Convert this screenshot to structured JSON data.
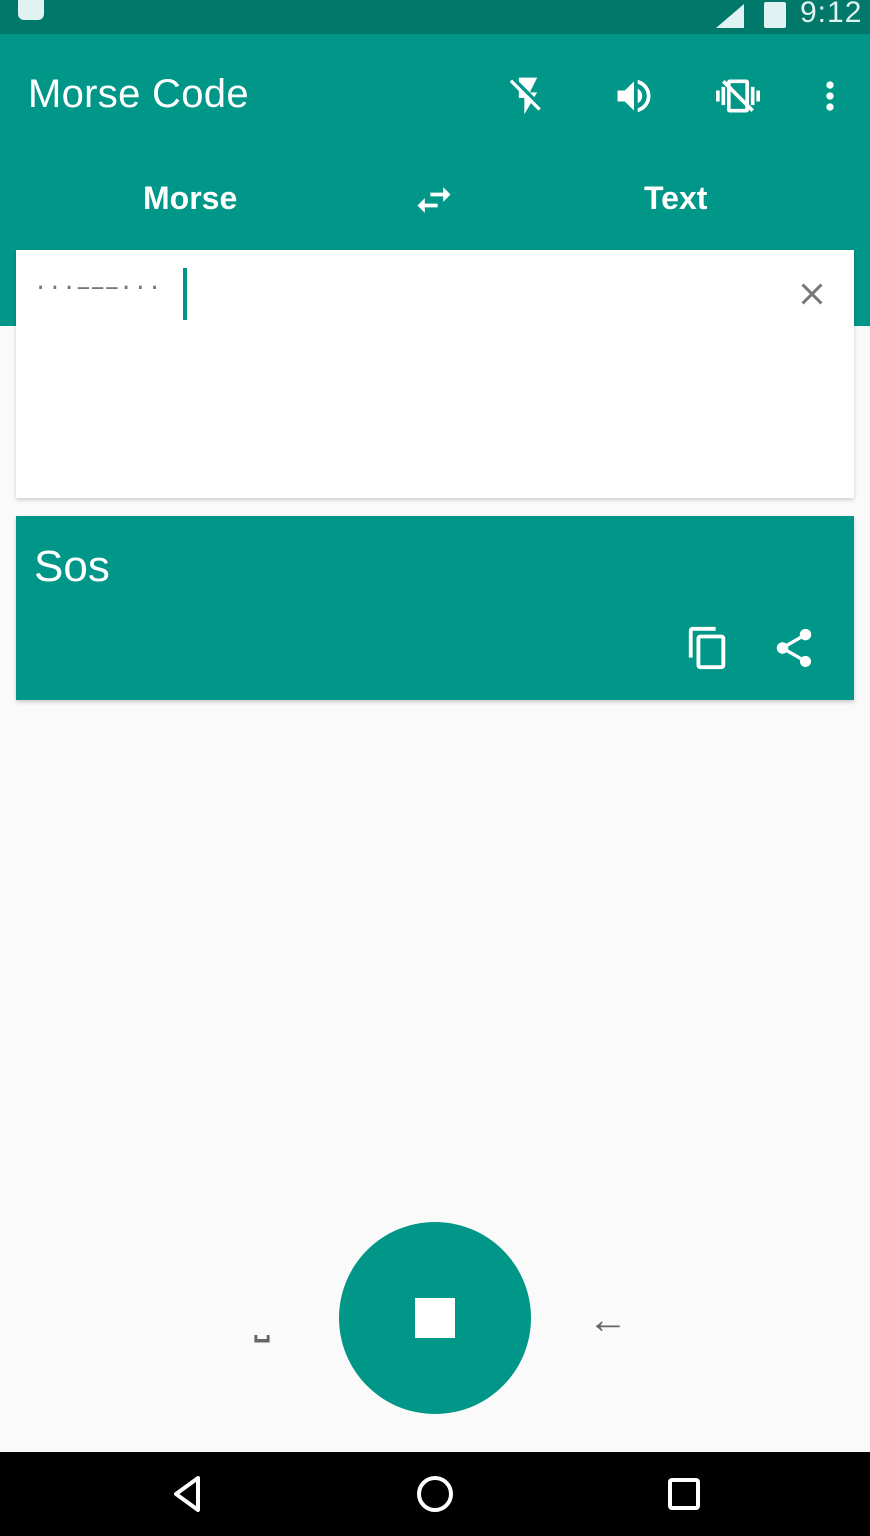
{
  "status_bar": {
    "time": "9:12"
  },
  "app_bar": {
    "title": "Morse Code",
    "actions": [
      "flash-off-icon",
      "volume-up-icon",
      "vibrate-off-icon",
      "more-vert-icon"
    ]
  },
  "tabs": {
    "left": "Morse",
    "right": "Text"
  },
  "input": {
    "value": "···−−−···"
  },
  "output": {
    "value": "Sos"
  },
  "keypad": {
    "space_label": "⎵",
    "backspace_label": "←"
  },
  "colors": {
    "primary": "#009688",
    "primary_dark": "#00796b",
    "background": "#fafafa"
  }
}
